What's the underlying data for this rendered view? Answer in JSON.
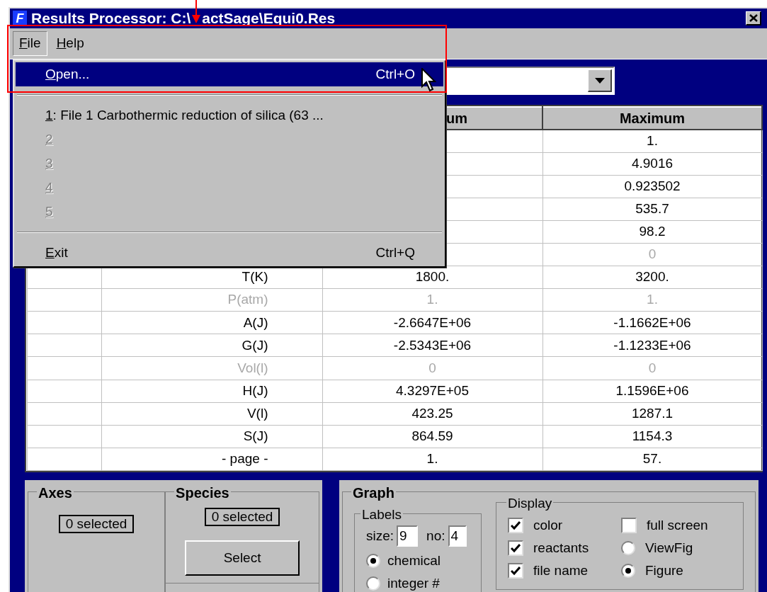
{
  "window": {
    "title_parts": [
      "Results Processor: C:\\",
      "actSage\\Equi0.Res"
    ],
    "icon_letter": "F"
  },
  "menu_bar": [
    {
      "key": "F",
      "text": "ile",
      "selected": true
    },
    {
      "key": "H",
      "text": "elp",
      "selected": false
    }
  ],
  "file_menu": [
    {
      "kind": "item",
      "key": "O",
      "text": "pen...",
      "shortcut": "Ctrl+O",
      "selected": true,
      "disabled": false
    },
    {
      "kind": "separator"
    },
    {
      "kind": "item",
      "key": "1",
      "text": ": File 1  Carbothermic reduction of silica (63  ...",
      "selected": false,
      "disabled": false
    },
    {
      "kind": "item",
      "key": "2",
      "selected": false,
      "disabled": true
    },
    {
      "kind": "item",
      "key": "3",
      "selected": false,
      "disabled": true
    },
    {
      "kind": "item",
      "key": "4",
      "selected": false,
      "disabled": true
    },
    {
      "kind": "item",
      "key": "5",
      "selected": false,
      "disabled": true
    },
    {
      "kind": "separator"
    },
    {
      "kind": "item",
      "key": "E",
      "text": "xit",
      "shortcut": "Ctrl+Q",
      "selected": false,
      "disabled": false
    }
  ],
  "table": {
    "header": {
      "column_3": "um",
      "column_4": "Maximum"
    },
    "rows": [
      {
        "max": "1.",
        "disabled": false
      },
      {
        "max": "4.9016",
        "disabled": false
      },
      {
        "max": "0.923502",
        "disabled": false
      },
      {
        "max": "535.7",
        "disabled": false
      },
      {
        "max": "98.2",
        "disabled": false
      },
      {
        "max": "0",
        "disabled": true
      },
      {
        "label": "T(K)",
        "min": "1800.",
        "max": "3200.",
        "disabled": false
      },
      {
        "label": "P(atm)",
        "min": "1.",
        "max": "1.",
        "disabled": true
      },
      {
        "label": "A(J)",
        "min": "-2.6647E+06",
        "max": "-1.1662E+06",
        "disabled": false
      },
      {
        "label": "G(J)",
        "min": "-2.5343E+06",
        "max": "-1.1233E+06",
        "disabled": false
      },
      {
        "label": "Vol(l)",
        "min": "0",
        "max": "0",
        "disabled": true
      },
      {
        "label": "H(J)",
        "min": "4.3297E+05",
        "max": "1.1596E+06",
        "disabled": false
      },
      {
        "label": "V(l)",
        "min": "423.25",
        "max": "1287.1",
        "disabled": false
      },
      {
        "label": "S(J)",
        "min": "864.59",
        "max": "1154.3",
        "disabled": false
      },
      {
        "label": "- page -",
        "min": "1.",
        "max": "57.",
        "disabled": false
      }
    ]
  },
  "axes": {
    "title": "Axes",
    "count": "0 selected"
  },
  "species": {
    "title": "Species",
    "count": "0 selected",
    "button": "Select"
  },
  "graph": {
    "title": "Graph",
    "labels": {
      "title": "Labels",
      "size_label": "size:",
      "size": "9",
      "no_label": "no:",
      "no": "4",
      "options": [
        {
          "label": "chemical",
          "selected": true
        },
        {
          "label": "integer #",
          "selected": false
        }
      ]
    },
    "display": {
      "title": "Display",
      "options": [
        {
          "kind": "checkbox",
          "label": "color",
          "checked": true
        },
        {
          "kind": "checkbox",
          "label": "reactants",
          "checked": true
        },
        {
          "kind": "checkbox",
          "label": "file name",
          "checked": true
        },
        {
          "kind": "checkbox",
          "label": "full screen",
          "checked": false
        },
        {
          "kind": "radio",
          "label": "ViewFig",
          "selected": false
        },
        {
          "kind": "radio",
          "label": "Figure",
          "selected": true
        }
      ]
    }
  }
}
